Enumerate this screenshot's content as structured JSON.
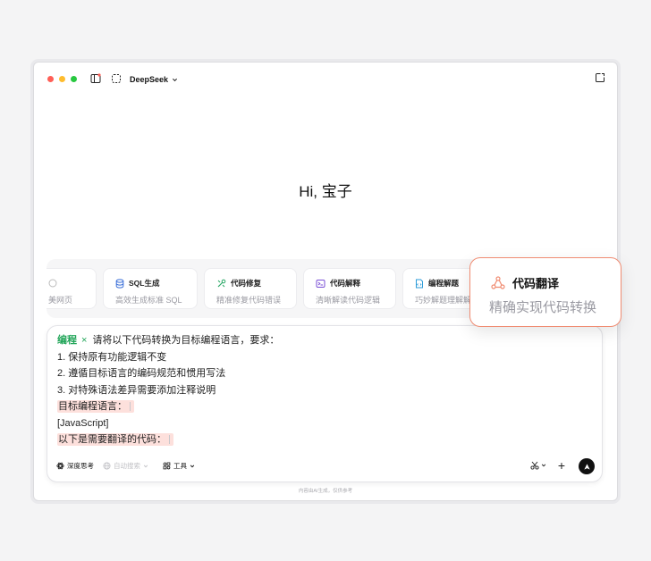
{
  "app": {
    "model_name": "DeepSeek"
  },
  "greeting": "Hi, 宝子",
  "cards": [
    {
      "title": "",
      "desc": "美网页"
    },
    {
      "title": "SQL生成",
      "desc": "高效生成标准 SQL"
    },
    {
      "title": "代码修复",
      "desc": "精准修复代码错误"
    },
    {
      "title": "代码解释",
      "desc": "清晰解读代码逻辑"
    },
    {
      "title": "编程解题",
      "desc": "巧妙解题理解解"
    }
  ],
  "prompt": {
    "tag": "编程",
    "tag_close": "×",
    "intro": "请将以下代码转换为目标编程语言，要求：",
    "lines": [
      "1. 保持原有功能逻辑不变",
      "2. 遵循目标语言的编码规范和惯用写法",
      "3. 对特殊语法差异需要添加注释说明"
    ],
    "target_label": "目标编程语言：",
    "target_value": "[JavaScript]",
    "code_label": "以下是需要翻译的代码："
  },
  "toolbar": {
    "deep_think": "深度思考",
    "auto_search": "自动搜索",
    "tools": "工具",
    "plus": "+"
  },
  "footnote": "内容由AI生成，仅供参考",
  "popup": {
    "title": "代码翻译",
    "desc": "精确实现代码转换",
    "accent": "#f08c72"
  },
  "colors": {
    "tag_green": "#22a559",
    "highlight": "#fde0dc",
    "traffic": [
      "#ff5f57",
      "#febc2e",
      "#28c840"
    ]
  }
}
